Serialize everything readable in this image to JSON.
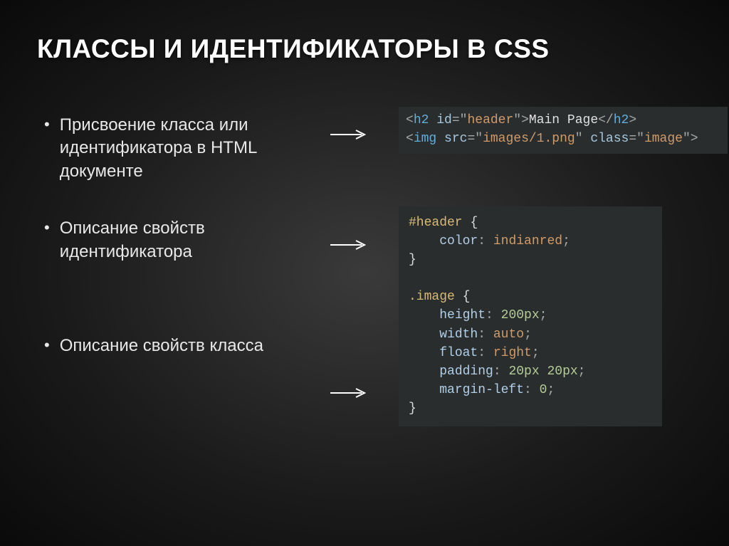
{
  "title": "КЛАССЫ И ИДЕНТИФИКАТОРЫ В CSS",
  "bullets": {
    "b1": "Присвоение класса или идентификатора в HTML документе",
    "b2": "Описание свойств идентификатора",
    "b3": "Описание свойств класса"
  },
  "code_html": {
    "l1": {
      "lt": "<",
      "tag": "h2",
      "sp": " ",
      "attr": "id",
      "eq": "=",
      "q1": "\"",
      "val": "header",
      "q2": "\"",
      "gt": ">",
      "text": "Main Page",
      "lt2": "</",
      "tag2": "h2",
      "gt2": ">"
    },
    "l2": {
      "lt": "<",
      "tag": "img",
      "sp": " ",
      "attr1": "src",
      "eq1": "=",
      "q1a": "\"",
      "val1": "images/1.png",
      "q1b": "\"",
      "sp2": " ",
      "attr2": "class",
      "eq2": "=",
      "q2a": "\"",
      "val2": "image",
      "q2b": "\"",
      "gt": ">"
    }
  },
  "code_css": {
    "l1": {
      "sel": "#header",
      "sp": " ",
      "br": "{"
    },
    "l2": {
      "indent": "    ",
      "prop": "color",
      "colon": ": ",
      "val": "indianred",
      "semi": ";"
    },
    "l3": {
      "br": "}"
    },
    "blank": "",
    "l4": {
      "sel": ".image",
      "sp": " ",
      "br": "{"
    },
    "l5": {
      "indent": "    ",
      "prop": "height",
      "colon": ": ",
      "val": "200px",
      "semi": ";"
    },
    "l6": {
      "indent": "    ",
      "prop": "width",
      "colon": ": ",
      "val": "auto",
      "semi": ";"
    },
    "l7": {
      "indent": "    ",
      "prop": "float",
      "colon": ": ",
      "val": "right",
      "semi": ";"
    },
    "l8": {
      "indent": "    ",
      "prop": "padding",
      "colon": ": ",
      "val": "20px 20px",
      "semi": ";"
    },
    "l9": {
      "indent": "    ",
      "prop": "margin-left",
      "colon": ": ",
      "val": "0",
      "semi": ";"
    },
    "l10": {
      "br": "}"
    }
  }
}
